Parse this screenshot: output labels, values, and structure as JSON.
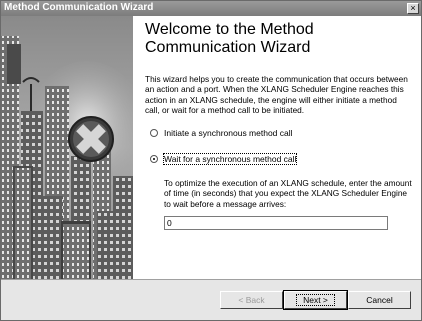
{
  "window": {
    "title": "Method Communication Wizard",
    "close_glyph": "×"
  },
  "art": {
    "icon": "plus-circle-icon"
  },
  "main": {
    "heading": "Welcome to the Method Communication Wizard",
    "intro": "This wizard helps you to create the communication that occurs between an action and a port. When the XLANG Scheduler Engine reaches this action in an XLANG schedule, the engine will either initiate a method call, or wait for a method call to be initiated.",
    "options": [
      {
        "label": "Initiate a synchronous method call",
        "checked": false
      },
      {
        "label": "Wait for a synchronous method call",
        "checked": true
      }
    ],
    "description": "To optimize the execution of an XLANG schedule, enter the amount of time (in seconds) that you expect the XLANG Scheduler Engine to wait before a message arrives:",
    "timeout_value": "0"
  },
  "buttons": {
    "back": "< Back",
    "next": "Next >",
    "cancel": "Cancel"
  }
}
